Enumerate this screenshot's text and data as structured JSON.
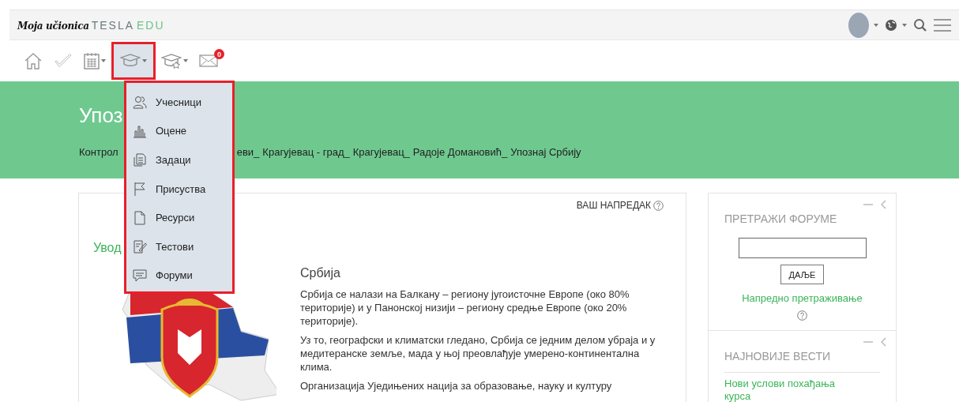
{
  "header": {
    "logo_script": "Moja učionica",
    "logo_brand": "TESLA",
    "logo_brand_accent": "EDU"
  },
  "toolbar": [
    {
      "kind": "home",
      "selected": false
    },
    {
      "kind": "check",
      "selected": false
    },
    {
      "kind": "calendar",
      "selected": false
    },
    {
      "kind": "course",
      "selected": true,
      "menu_open": true
    },
    {
      "kind": "course-star",
      "selected": false
    },
    {
      "kind": "mail",
      "selected": false,
      "badge": "0"
    }
  ],
  "course_menu": [
    {
      "kind": "participants",
      "label": "Учесници"
    },
    {
      "kind": "grades",
      "label": "Оцене"
    },
    {
      "kind": "assignments",
      "label": "Задаци"
    },
    {
      "kind": "attendance",
      "label": "Присуства"
    },
    {
      "kind": "resources",
      "label": "Ресурси"
    },
    {
      "kind": "tests",
      "label": "Тестови"
    },
    {
      "kind": "forums",
      "label": "Форуми"
    }
  ],
  "banner": {
    "title": "Упоз",
    "breadcrumb_before": "Контрол",
    "breadcrumb": [
      "еви_",
      "Крагујевац - град_",
      "Крагујевац_",
      "Радоје Домановић_",
      "Упознај Србију"
    ]
  },
  "main": {
    "progress_label": "ВАШ НАПРЕДАК",
    "section_title": "Увод",
    "heading": "Србија",
    "paragraphs": [
      "Србија се налази на Балкану – региону југоисточне Европе (око 80% територије) и у Панонској низији – региону средње Европе (око 20% територије).",
      "Уз то, географски и климатски гледано, Србија се једним делом убраја и у медитеранске земље, мада у њој преовлађује умерено-континентална клима.",
      "Организација Уједињених нација за образовање, науку и културу"
    ]
  },
  "sidebar": [
    {
      "kind": "search",
      "title": "ПРЕТРАЖИ ФОРУМЕ",
      "button": "ДАЉЕ",
      "link": "Напредно претраживање"
    },
    {
      "kind": "news",
      "title": "НАЈНОВИЈЕ ВЕСТИ",
      "items": [
        "Нови услови похађања курса"
      ]
    }
  ]
}
